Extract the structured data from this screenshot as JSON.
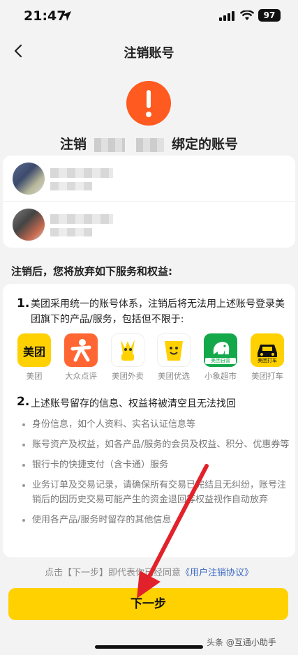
{
  "status_bar": {
    "time": "21:47",
    "battery": "97"
  },
  "nav": {
    "title": "注销账号"
  },
  "heading": {
    "prefix": "注销",
    "suffix": "绑定的账号"
  },
  "section_title": "注销后，您将放弃如下服务和权益:",
  "point1": {
    "num": "1.",
    "text": "美团采用统一的账号体系，注销后将无法用上述账号登录美团旗下的产品/服务，包括但不限于:",
    "apps": [
      {
        "label": "美团",
        "icon_text": "美团",
        "icon": "meituan-app-icon"
      },
      {
        "label": "大众点评",
        "icon_text": "",
        "icon": "dianping-app-icon"
      },
      {
        "label": "美团外卖",
        "icon_text": "",
        "icon": "waimai-app-icon"
      },
      {
        "label": "美团优选",
        "icon_text": "",
        "icon": "youxuan-app-icon"
      },
      {
        "label": "小象超市",
        "icon_text": "美团自营",
        "icon": "xiaoxiang-app-icon"
      },
      {
        "label": "美团打车",
        "icon_text": "美团打车",
        "icon": "dache-app-icon"
      }
    ]
  },
  "point2": {
    "num": "2.",
    "text": "上述账号留存的信息、权益将被清空且无法找回",
    "bullets": [
      "身份信息，如个人资料、实名认证信息等",
      "账号资产及权益，如各产品/服务的会员及权益、积分、优惠券等",
      "银行卡的快捷支付（含卡通）服务",
      "业务订单及交易记录，请确保所有交易已完结且无纠纷，账号注销后的因历史交易可能产生的资金退回等权益视作自动放弃",
      "使用各产品/服务时留存的其他信息"
    ]
  },
  "agreement": {
    "text": "点击【下一步】即代表你已经同意",
    "link": "《用户注销协议》"
  },
  "next_button": "下一步",
  "watermark": "头条 @互通小助手",
  "colors": {
    "accent": "#ffd100",
    "warning": "#ff5a1f",
    "link": "#3a67c2"
  }
}
